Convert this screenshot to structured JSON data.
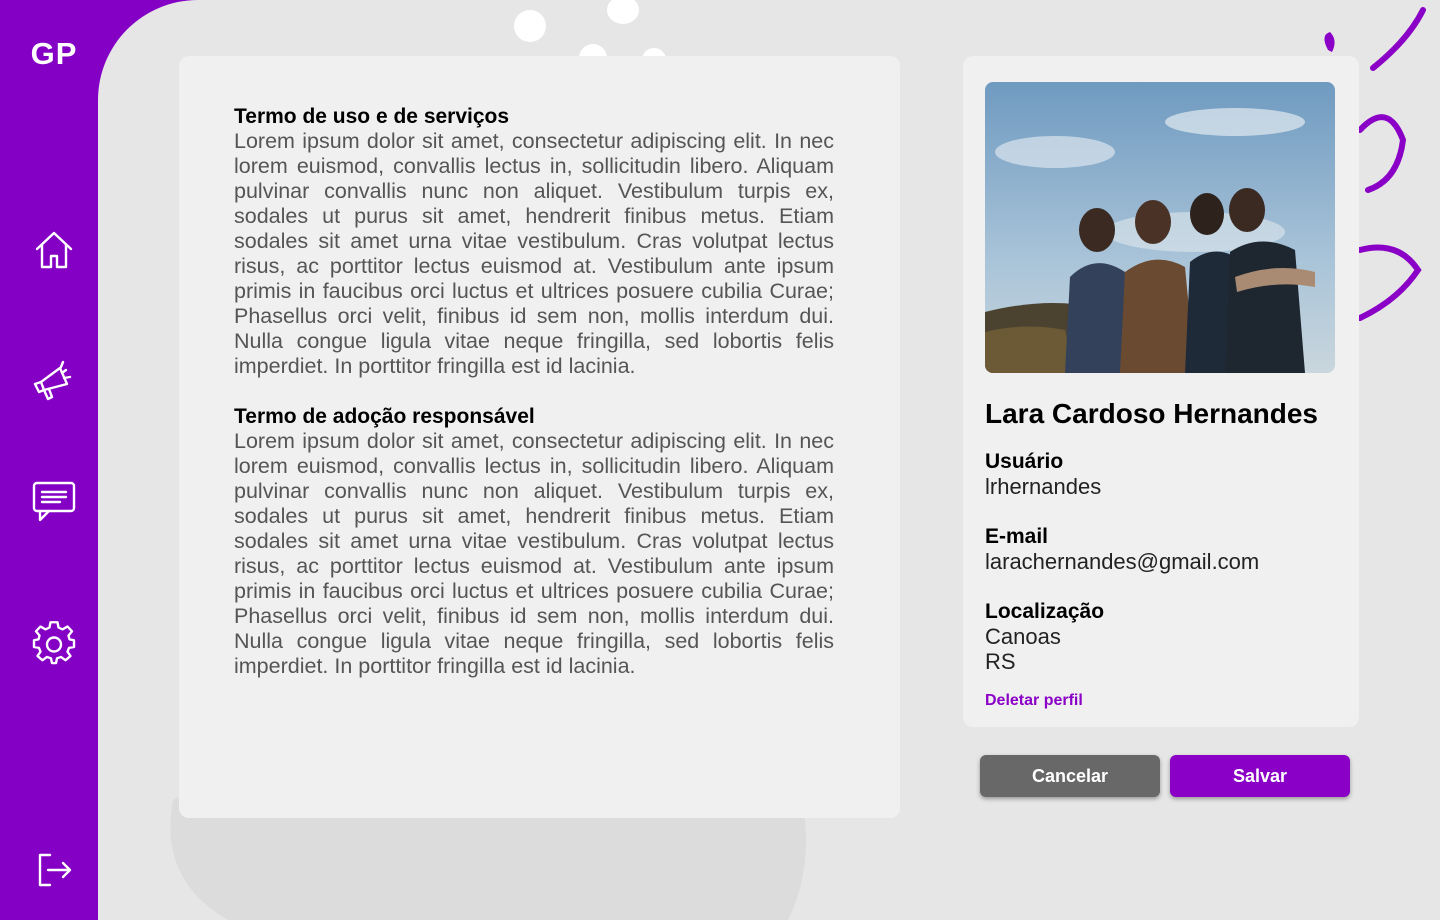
{
  "brand": {
    "name": "GP"
  },
  "colors": {
    "accent": "#8300c4",
    "surface": "#e6e6e6",
    "card": "#f0f0f0",
    "cancel": "#686868"
  },
  "sidebar": {
    "items": [
      {
        "icon": "home-icon"
      },
      {
        "icon": "megaphone-icon"
      },
      {
        "icon": "chat-icon"
      },
      {
        "icon": "gear-icon"
      },
      {
        "icon": "logout-icon"
      }
    ]
  },
  "terms": [
    {
      "title": "Termo de uso e de serviços",
      "body": "Lorem ipsum dolor sit amet, consectetur adipiscing elit. In nec lorem euismod, convallis lectus in, sollicitudin libero. Aliquam pulvinar convallis nunc non aliquet. Vestibulum turpis ex, sodales ut purus sit amet, hendrerit finibus metus. Etiam sodales sit amet urna vitae vestibulum. Cras volutpat lectus risus, ac porttitor lectus euismod at. Vestibulum ante ipsum primis in faucibus orci luctus et ultrices posuere cubilia Curae; Phasellus orci velit, finibus id sem non, mollis interdum dui. Nulla congue ligula vitae neque fringilla, sed lobortis felis imperdiet. In porttitor fringilla est id lacinia."
    },
    {
      "title": "Termo de adoção responsável",
      "body": "Lorem ipsum dolor sit amet, consectetur adipiscing elit. In nec lorem euismod, convallis lectus in, sollicitudin libero. Aliquam pulvinar convallis nunc non aliquet. Vestibulum turpis ex, sodales ut purus sit amet, hendrerit finibus metus. Etiam sodales sit amet urna vitae vestibulum. Cras volutpat lectus risus, ac porttitor lectus euismod at. Vestibulum ante ipsum primis in faucibus orci luctus et ultrices posuere cubilia Curae; Phasellus orci velit, finibus id sem non, mollis interdum dui. Nulla congue ligula vitae neque fringilla, sed lobortis felis imperdiet. In porttitor fringilla est id lacinia."
    }
  ],
  "profile": {
    "name": "Lara Cardoso Hernandes",
    "username_label": "Usuário",
    "username": "lrhernandes",
    "email_label": "E-mail",
    "email": "larachernandes@gmail.com",
    "location_label": "Localização",
    "city": "Canoas",
    "state": "RS",
    "delete_label": "Deletar perfil"
  },
  "actions": {
    "cancel_label": "Cancelar",
    "save_label": "Salvar"
  }
}
